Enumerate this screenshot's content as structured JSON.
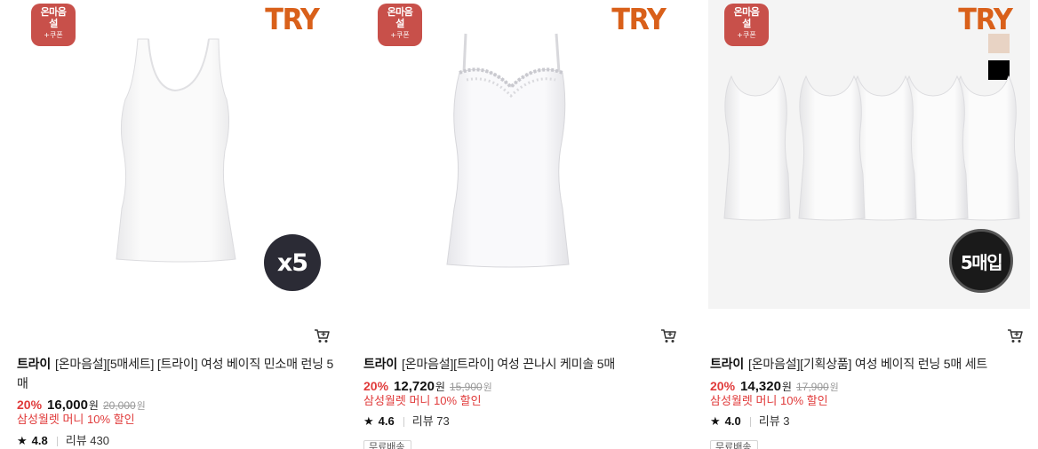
{
  "products": [
    {
      "promo": {
        "text": "온마음\n설",
        "coupon": "+쿠폰"
      },
      "logo": "TRY",
      "badge": "x5",
      "brand": "트라이",
      "title": "[온마음설][5매세트] [트라이] 여성 베이직 민소매 런닝 5매",
      "discount": "20%",
      "price": "16,000",
      "currency": "원",
      "original_price": "20,000",
      "benefit": "삼성월렛 머니 10% 할인",
      "rating": "4.8",
      "reviews": "리뷰 430"
    },
    {
      "promo": {
        "text": "온마음\n설",
        "coupon": "+쿠폰"
      },
      "logo": "TRY",
      "brand": "트라이",
      "title": "[온마음설][트라이] 여성 끈나시 케미솔 5매",
      "discount": "20%",
      "price": "12,720",
      "currency": "원",
      "original_price": "15,900",
      "benefit": "삼성월렛 머니 10% 할인",
      "rating": "4.6",
      "reviews": "리뷰 73",
      "tag": "무료배송"
    },
    {
      "promo": {
        "text": "온마음\n설",
        "coupon": "+쿠폰"
      },
      "logo": "TRY",
      "badge": "5매입",
      "swatches": [
        "#e8d3c4",
        "#000000"
      ],
      "brand": "트라이",
      "title": "[온마음설][기획상품] 여성 베이직 런닝 5매 세트",
      "discount": "20%",
      "price": "14,320",
      "currency": "원",
      "original_price": "17,900",
      "benefit": "삼성월렛 머니 10% 할인",
      "rating": "4.0",
      "reviews": "리뷰 3",
      "tag": "무료배송"
    }
  ],
  "icons": {
    "cart": "cart-icon",
    "star": "star-icon"
  },
  "colors": {
    "discount": "#e03a3a",
    "promo_bg": "#c8504a",
    "logo": "#d9601a"
  }
}
